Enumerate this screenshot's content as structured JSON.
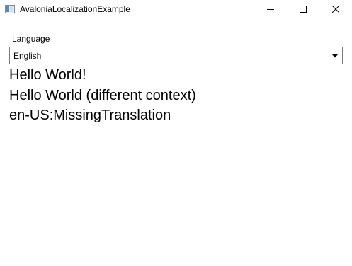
{
  "window": {
    "title": "AvaloniaLocalizationExample",
    "icon": "app-window-icon",
    "controls": {
      "minimize": "minimize-icon",
      "maximize": "maximize-icon",
      "close": "close-icon"
    }
  },
  "language": {
    "label": "Language",
    "selected": "English",
    "arrow_icon": "dropdown-arrow-icon"
  },
  "texts": {
    "hello": "Hello World!",
    "hello_context": "Hello World (different context)",
    "missing": "en-US:MissingTranslation"
  },
  "colors": {
    "background": "#ffffff",
    "border": "#7a7a7a",
    "text": "#000000"
  }
}
